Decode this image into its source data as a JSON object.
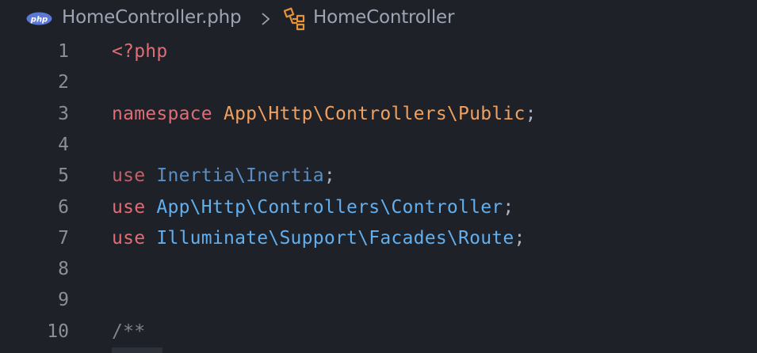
{
  "breadcrumb": {
    "file_icon": "php-file-icon",
    "file_icon_text": "php",
    "file_name": "HomeController.php",
    "separator_icon": "chevron-right-icon",
    "symbol_icon": "class-symbol-icon",
    "symbol_name": "HomeController"
  },
  "editor": {
    "lines": [
      {
        "number": "1",
        "tokens": [
          {
            "text": "<?php",
            "type": "php-tag"
          }
        ]
      },
      {
        "number": "2",
        "tokens": []
      },
      {
        "number": "3",
        "tokens": [
          {
            "text": "namespace ",
            "type": "kw"
          },
          {
            "text": "App\\Http\\Controllers\\Public",
            "type": "ns"
          },
          {
            "text": ";",
            "type": "punct"
          }
        ]
      },
      {
        "number": "4",
        "tokens": []
      },
      {
        "number": "5",
        "tokens": [
          {
            "text": "use ",
            "type": "kw-dim"
          },
          {
            "text": "Inertia\\Inertia",
            "type": "cls-dim"
          },
          {
            "text": ";",
            "type": "punct"
          }
        ]
      },
      {
        "number": "6",
        "tokens": [
          {
            "text": "use ",
            "type": "kw"
          },
          {
            "text": "App\\Http\\Controllers\\Controller",
            "type": "cls"
          },
          {
            "text": ";",
            "type": "punct"
          }
        ]
      },
      {
        "number": "7",
        "tokens": [
          {
            "text": "use ",
            "type": "kw"
          },
          {
            "text": "Illuminate\\Support\\Facades\\Route",
            "type": "cls"
          },
          {
            "text": ";",
            "type": "punct"
          }
        ]
      },
      {
        "number": "8",
        "tokens": []
      },
      {
        "number": "9",
        "tokens": []
      },
      {
        "number": "10",
        "tokens": [
          {
            "text": "/**",
            "type": "comment"
          }
        ]
      }
    ]
  },
  "colors": {
    "background": "#1e2127",
    "line_number": "#8a9099",
    "keyword": "#e06c75",
    "namespace": "#f0a060",
    "class_name": "#61afef",
    "php_icon_bg": "#4f5b93"
  }
}
